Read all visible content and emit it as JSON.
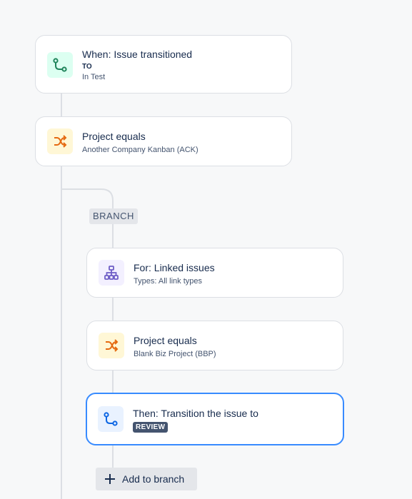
{
  "rules": {
    "trigger": {
      "title": "When: Issue transitioned",
      "to_label": "TO",
      "status": "In Test"
    },
    "condition1": {
      "title": "Project equals",
      "subtitle": "Another Company Kanban (ACK)"
    },
    "branch_label": "BRANCH",
    "branch_for": {
      "title": "For: Linked issues",
      "subtitle": "Types: All link types"
    },
    "condition2": {
      "title": "Project equals",
      "subtitle": "Blank Biz Project (BBP)"
    },
    "action": {
      "title": "Then: Transition the issue to",
      "status_lozenge": "REVIEW"
    },
    "add_to_branch": "Add to branch"
  },
  "colors": {
    "trigger_icon": "#1f845a",
    "condition_icon": "#e56910",
    "branch_icon": "#6e5dc6",
    "action_icon": "#0c66e4",
    "selected_border": "#388bff"
  },
  "icons": {
    "trigger": "transition-icon",
    "condition": "shuffle-icon",
    "branch": "hierarchy-icon",
    "action": "transition-icon"
  }
}
